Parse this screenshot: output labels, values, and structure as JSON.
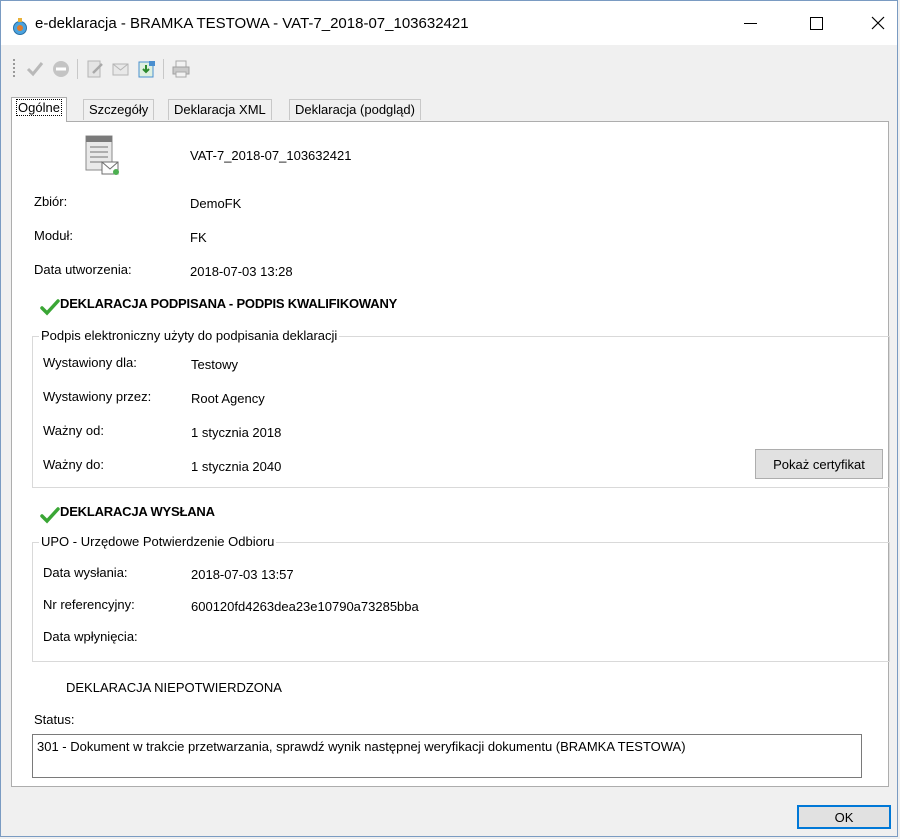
{
  "window": {
    "title": "e-deklaracja - BRAMKA TESTOWA - VAT-7_2018-07_103632421",
    "app_icon": "e-deklaracja-app-icon"
  },
  "toolbar": {
    "icons": [
      "check-icon",
      "cancel-icon",
      "sign-icon",
      "send-icon",
      "download-upo-icon",
      "print-icon"
    ]
  },
  "tabs": [
    {
      "label": "Ogólne",
      "active": true
    },
    {
      "label": "Szczegóły",
      "active": false
    },
    {
      "label": "Deklaracja XML",
      "active": false
    },
    {
      "label": "Deklaracja (podgląd)",
      "active": false
    }
  ],
  "general": {
    "file_name": "VAT-7_2018-07_103632421",
    "zbior_label": "Zbiór:",
    "zbior_value": "DemoFK",
    "modul_label": "Moduł:",
    "modul_value": "FK",
    "created_label": "Data utworzenia:",
    "created_value": "2018-07-03 13:28"
  },
  "signature": {
    "heading": "DEKLARACJA PODPISANA - PODPIS KWALIFIKOWANY",
    "group_title": "Podpis elektroniczny użyty do podpisania deklaracji",
    "issued_for_label": "Wystawiony dla:",
    "issued_for_value": "Testowy",
    "issued_by_label": "Wystawiony przez:",
    "issued_by_value": "Root Agency",
    "valid_from_label": "Ważny od:",
    "valid_from_value": "1 stycznia 2018",
    "valid_to_label": "Ważny do:",
    "valid_to_value": "1 stycznia 2040",
    "show_cert_label": "Pokaż certyfikat"
  },
  "sent": {
    "heading": "DEKLARACJA WYSŁANA",
    "group_title": "UPO - Urzędowe Potwierdzenie Odbioru",
    "sent_date_label": "Data wysłania:",
    "sent_date_value": "2018-07-03 13:57",
    "ref_label": "Nr referencyjny:",
    "ref_value": "600120fd4263dea23e10790a73285bba",
    "received_label": "Data wpłynięcia:",
    "received_value": ""
  },
  "status": {
    "unconfirmed": "DEKLARACJA NIEPOTWIERDZONA",
    "label": "Status:",
    "text": "301 - Dokument w trakcie przetwarzania, sprawdź wynik następnej weryfikacji dokumentu (BRAMKA TESTOWA)"
  },
  "footer": {
    "ok_label": "OK"
  },
  "colors": {
    "check_green": "#3aa635",
    "ok_border": "#0078d7"
  }
}
